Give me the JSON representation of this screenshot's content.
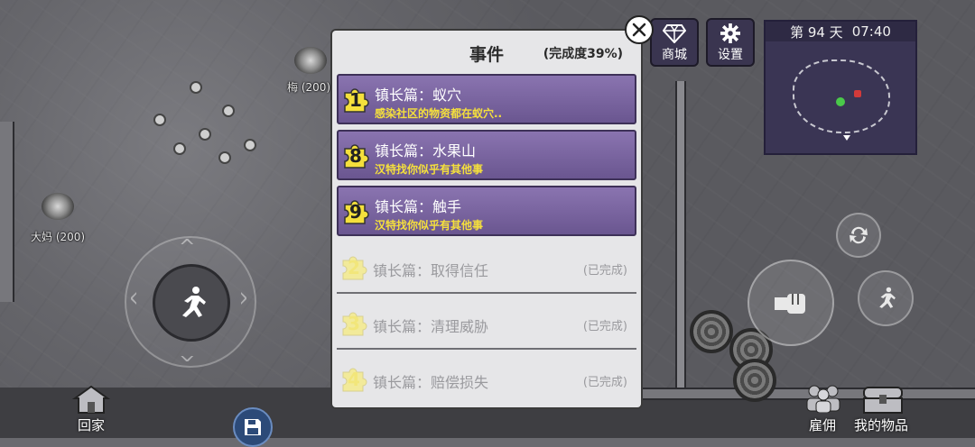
{
  "hud": {
    "day_label": "第 94 天",
    "clock": "07:40",
    "shop_label": "商城",
    "settings_label": "设置",
    "home_label": "回家",
    "hire_label": "雇佣",
    "inventory_label": "我的物品"
  },
  "world": {
    "npc_mei": "梅 (200)",
    "npc_dama": "大妈 (200)"
  },
  "dialog": {
    "title": "事件",
    "progress": "(完成度39%)",
    "events": [
      {
        "num": "1",
        "name": "镇长篇：蚁穴",
        "desc": "感染社区的物资都在蚁穴..",
        "status": ""
      },
      {
        "num": "8",
        "name": "镇长篇：水果山",
        "desc": "汉特找你似乎有其他事",
        "status": ""
      },
      {
        "num": "9",
        "name": "镇长篇：触手",
        "desc": "汉特找你似乎有其他事",
        "status": ""
      },
      {
        "num": "2",
        "name": "镇长篇：取得信任",
        "desc": "",
        "status": "(已完成)"
      },
      {
        "num": "3",
        "name": "镇长篇：清理威胁",
        "desc": "",
        "status": "(已完成)"
      },
      {
        "num": "4",
        "name": "镇长篇：赔偿损失",
        "desc": "",
        "status": "(已完成)"
      }
    ]
  },
  "colors": {
    "active_badge": "#f5e03c",
    "done_badge": "#f2ea9a",
    "active_bg": "#7a65a2",
    "desc_text": "#f5e03c"
  },
  "icons": [
    "diamond-icon",
    "gear-icon",
    "close-icon",
    "run-icon",
    "fist-icon",
    "sprint-icon",
    "swap-icon",
    "save-icon",
    "house-icon",
    "people-icon",
    "chest-icon",
    "puzzle-icon"
  ]
}
